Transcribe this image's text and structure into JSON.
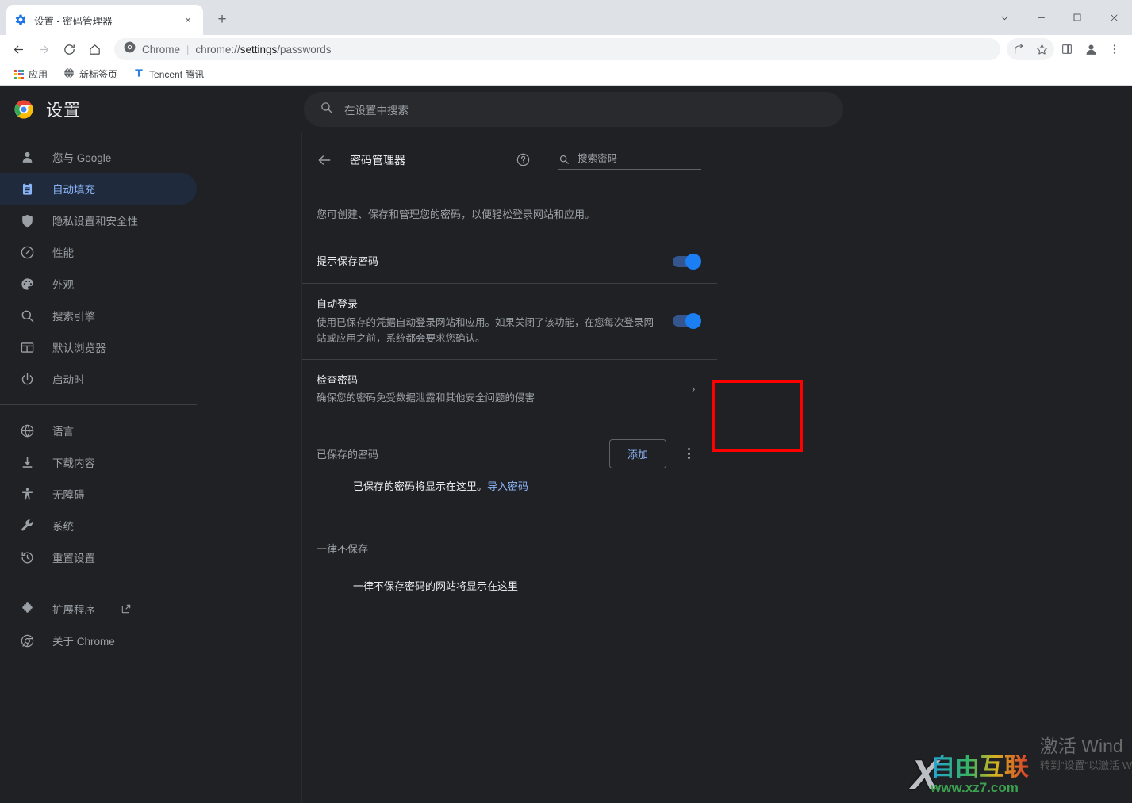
{
  "browser": {
    "tab": {
      "title": "设置 - 密码管理器",
      "favicon": "settings-gear-icon",
      "close_label": "×"
    },
    "newtab_label": "+",
    "window_controls": [
      {
        "name": "tab-search-button",
        "glyph": "chevron-down-icon"
      },
      {
        "name": "minimize-button",
        "glyph": "minimize-icon"
      },
      {
        "name": "maximize-button",
        "glyph": "maximize-icon"
      },
      {
        "name": "close-button",
        "glyph": "close-icon"
      }
    ],
    "nav": {
      "back": "back-arrow-icon",
      "forward": "forward-arrow-icon",
      "reload": "reload-icon",
      "home": "home-icon"
    },
    "omnibox": {
      "chrome_label": "Chrome",
      "separator": "|",
      "url_prefix": "chrome://",
      "url_bold": "settings",
      "url_suffix": "/passwords",
      "full_url": "chrome://settings/passwords"
    },
    "toolbar_icons": [
      {
        "name": "share-icon",
        "label": "分享"
      },
      {
        "name": "bookmark-star-icon",
        "label": "收藏"
      },
      {
        "name": "side-panel-icon",
        "label": "侧边栏"
      },
      {
        "name": "profile-avatar-icon",
        "label": "个人资料"
      },
      {
        "name": "more-menu-icon",
        "label": "自定义及控制"
      }
    ],
    "bookmarks": [
      {
        "label": "应用",
        "icon": "apps-grid-icon"
      },
      {
        "label": "新标签页",
        "icon": "globe-icon"
      },
      {
        "label": "Tencent 腾讯",
        "icon": "tencent-icon"
      }
    ]
  },
  "settings": {
    "brand_title": "设置",
    "brand_icon": "chrome-logo-icon",
    "search": {
      "placeholder": "在设置中搜索",
      "icon": "search-icon"
    },
    "sidebar": {
      "items": [
        {
          "label": "您与 Google",
          "icon": "person-icon",
          "active": false
        },
        {
          "label": "自动填充",
          "icon": "autofill-clipboard-icon",
          "active": true
        },
        {
          "label": "隐私设置和安全性",
          "icon": "shield-icon",
          "active": false
        },
        {
          "label": "性能",
          "icon": "speedometer-icon",
          "active": false
        },
        {
          "label": "外观",
          "icon": "palette-icon",
          "active": false
        },
        {
          "label": "搜索引擎",
          "icon": "search-icon",
          "active": false
        },
        {
          "label": "默认浏览器",
          "icon": "browser-window-icon",
          "active": false
        },
        {
          "label": "启动时",
          "icon": "power-icon",
          "active": false
        }
      ],
      "items2": [
        {
          "label": "语言",
          "icon": "globe-icon",
          "active": false
        },
        {
          "label": "下载内容",
          "icon": "download-icon",
          "active": false
        },
        {
          "label": "无障碍",
          "icon": "accessibility-icon",
          "active": false
        },
        {
          "label": "系统",
          "icon": "wrench-icon",
          "active": false
        },
        {
          "label": "重置设置",
          "icon": "history-restore-icon",
          "active": false
        }
      ],
      "items3": [
        {
          "label": "扩展程序",
          "icon": "puzzle-icon",
          "external": true,
          "active": false
        },
        {
          "label": "关于 Chrome",
          "icon": "chrome-outline-icon",
          "external": false,
          "active": false
        }
      ]
    }
  },
  "main": {
    "back_icon": "back-arrow-icon",
    "title": "密码管理器",
    "help_icon": "help-circle-icon",
    "password_search": {
      "icon": "search-icon",
      "placeholder": "搜索密码"
    },
    "description": "您可创建、保存和管理您的密码，以便轻松登录网站和应用。",
    "rows": [
      {
        "title": "提示保存密码",
        "subtitle": "",
        "control": "toggle",
        "toggle_on": true
      },
      {
        "title": "自动登录",
        "subtitle": "使用已保存的凭据自动登录网站和应用。如果关闭了该功能，在您每次登录网站或应用之前，系统都会要求您确认。",
        "control": "toggle",
        "toggle_on": true
      },
      {
        "title": "检查密码",
        "subtitle": "确保您的密码免受数据泄露和其他安全问题的侵害",
        "control": "chevron",
        "chevron_glyph": "›"
      }
    ],
    "saved_section": {
      "label": "已保存的密码",
      "add_button": "添加",
      "kebab_icon": "more-vertical-icon",
      "empty_text": "已保存的密码将显示在这里。",
      "empty_link": "导入密码"
    },
    "never_section": {
      "label": "一律不保存",
      "empty_text": "一律不保存密码的网站将显示在这里"
    }
  },
  "annotations": {
    "highlight_color": "#ff0000",
    "highlight_target": "add-button"
  },
  "watermarks": {
    "windows_line1": "激活 Wind",
    "windows_line2": "转到\"设置\"以激活 W",
    "site_x": "X",
    "site_name": "自由互联",
    "site_url": "www.xz7.com"
  },
  "colors": {
    "accent_blue": "#8ab4f8",
    "toggle_blue": "#1b7ef3",
    "page_bg": "#202124",
    "sidebar_active_bg": "#1f2a3d",
    "text_primary": "#e8eaed",
    "text_secondary": "#9aa0a6",
    "divider": "#3c4043",
    "chrome_light_bg": "#dee1e6"
  }
}
